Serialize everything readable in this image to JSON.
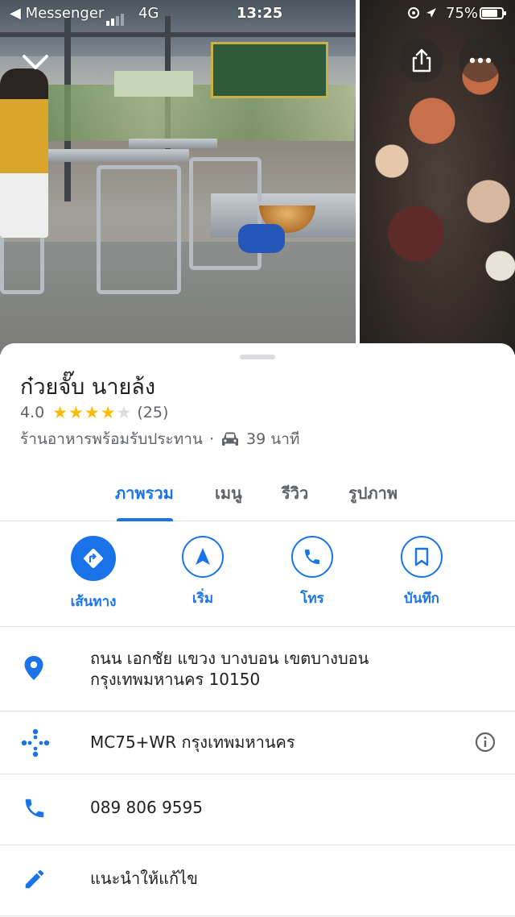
{
  "status_bar": {
    "back_app": "◀ Messenger",
    "network": "4G",
    "time": "13:25",
    "battery": "75%"
  },
  "place": {
    "name": "ก๋วยจั๊บ นายล้ง",
    "rating": "4.0",
    "stars_filled": 4,
    "review_count": "(25)",
    "category": "ร้านอาหารพร้อมรับประทาน",
    "separator": "·",
    "drive_time": "39 นาที"
  },
  "tabs": [
    {
      "label": "ภาพรวม",
      "active": true
    },
    {
      "label": "เมนู",
      "active": false
    },
    {
      "label": "รีวิว",
      "active": false
    },
    {
      "label": "รูปภาพ",
      "active": false
    }
  ],
  "actions": {
    "directions": "เส้นทาง",
    "start": "เริ่ม",
    "call": "โทร",
    "save": "บันทึก"
  },
  "info": {
    "address_line1": "ถนน เอกชัย แขวง บางบอน เขตบางบอน",
    "address_line2": "กรุงเทพมหานคร 10150",
    "plus_code": "MC75+WR กรุงเทพมหานคร",
    "phone": "089 806 9595",
    "suggest_edit": "แนะนำให้แก้ไข"
  },
  "colors": {
    "accent": "#1a73e8",
    "star": "#fbbc04",
    "text_secondary": "#5f6368"
  },
  "icons": [
    "chevron-down-icon",
    "share-icon",
    "more-icon",
    "car-icon",
    "directions-icon",
    "navigation-icon",
    "phone-icon",
    "bookmark-icon",
    "location-pin-icon",
    "plus-code-icon",
    "info-icon",
    "edit-pencil-icon"
  ]
}
